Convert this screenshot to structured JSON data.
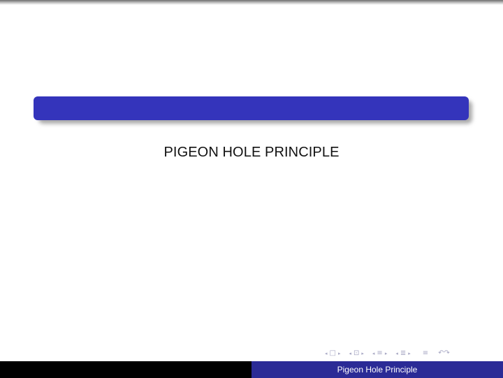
{
  "slide": {
    "title_bar_text": "",
    "subtitle": "PIGEON HOLE PRINCIPLE"
  },
  "navigation": {
    "icons": [
      "nav-left-arrow-icon",
      "frame-icon",
      "nav-right-arrow-icon",
      "nav-left-arrow-icon",
      "subsection-icon",
      "nav-right-arrow-icon",
      "nav-left-arrow-icon",
      "section-icon",
      "nav-right-arrow-icon",
      "nav-left-arrow-icon",
      "section-list-icon",
      "nav-right-arrow-icon",
      "document-icon",
      "search-undo-redo-icon"
    ],
    "glyphs": {
      "left_arrow": "◂",
      "right_arrow": "▸",
      "frame": "□",
      "subsection": "⊡",
      "section": "≡",
      "section_list": "≣",
      "document": "≡",
      "search": "↶↷"
    }
  },
  "footer": {
    "left_text": "",
    "right_text": "Pigeon Hole Principle"
  },
  "colors": {
    "title_bar": "#3434bb",
    "footer_left": "#000000",
    "footer_right": "#2b2b96",
    "nav_icons": "#a8a8c4"
  }
}
